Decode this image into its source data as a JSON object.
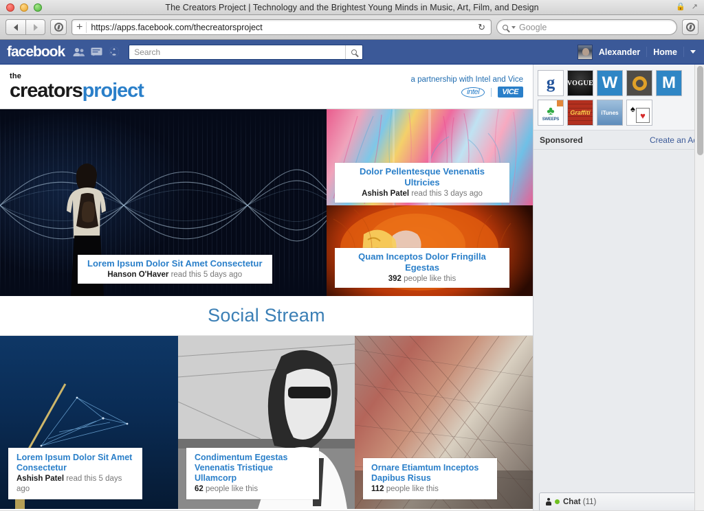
{
  "browser": {
    "window_title": "The Creators Project | Technology and the Brightest Young Minds in Music, Art, Film, and Design",
    "back_icon": "back-arrow-icon",
    "forward_icon": "forward-arrow-icon",
    "compass_icon": "compass-icon",
    "url_plus": "+",
    "url": "https://apps.facebook.com/thecreatorsproject",
    "reload_icon": "↻",
    "search_placeholder": "Google",
    "search_engine_icon": "magnifier-icon",
    "lock_icon": "lock-icon",
    "fullscreen_icon": "fullscreen-icon",
    "downloads_icon": "downloads-icon"
  },
  "facebook_bar": {
    "logo": "facebook",
    "icons": [
      "friend-requests-icon",
      "messages-icon",
      "notifications-icon"
    ],
    "search_placeholder": "Search",
    "search_button_icon": "search-icon",
    "user_name": "Alexander",
    "home_label": "Home",
    "account_caret_icon": "chevron-down-icon"
  },
  "app_header": {
    "logo_the": "the",
    "logo_creators": "creators",
    "logo_project": "project",
    "partnership_text": "a partnership with Intel and Vice",
    "intel_logo": "intel",
    "vice_logo": "VICE",
    "brand_blue": "#2a7fc9"
  },
  "hero": {
    "main": {
      "title": "Lorem Ipsum Dolor Sit Amet Consectetur",
      "author": "Hanson O'Haver",
      "meta": " read this 5 days ago"
    },
    "top": {
      "title": "Dolor Pellentesque Venenatis Ultricies",
      "author": "Ashish Patel",
      "meta": " read this 3 days ago"
    },
    "bottom": {
      "title": "Quam Inceptos Dolor Fringilla Egestas",
      "author": "392",
      "meta": " people like this"
    }
  },
  "stream": {
    "title": "Social Stream",
    "cards": [
      {
        "title": "Lorem Ipsum Dolor Sit Amet Consectetur",
        "author": "Ashish Patel",
        "meta": " read this 5 days ago"
      },
      {
        "title": "Condimentum Egestas Venenatis Tristique Ullamcorp",
        "author": "62",
        "meta": " people like this"
      },
      {
        "title": "Ornare Etiamtum Inceptos Dapibus Risus",
        "author": "112",
        "meta": " people like this"
      }
    ]
  },
  "sidebar": {
    "apps": [
      {
        "name": "g-app-icon",
        "label": "g"
      },
      {
        "name": "vogue-app-icon",
        "label": "VOGUE"
      },
      {
        "name": "w-app-icon",
        "label": "W"
      },
      {
        "name": "circle-app-icon",
        "label": ""
      },
      {
        "name": "m-app-icon",
        "label": "M"
      },
      {
        "name": "sweeps-app-icon",
        "label": "SWEEPS"
      },
      {
        "name": "graffiti-app-icon",
        "label": "Graffiti"
      },
      {
        "name": "itunes-app-icon",
        "label": "iTunes"
      },
      {
        "name": "cards-app-icon",
        "label": ""
      }
    ],
    "sponsored_label": "Sponsored",
    "create_ad_label": "Create an Ad"
  },
  "chat": {
    "person_icon": "person-icon",
    "online_dot": "online-status-dot",
    "label": "Chat",
    "count": "(11)"
  }
}
